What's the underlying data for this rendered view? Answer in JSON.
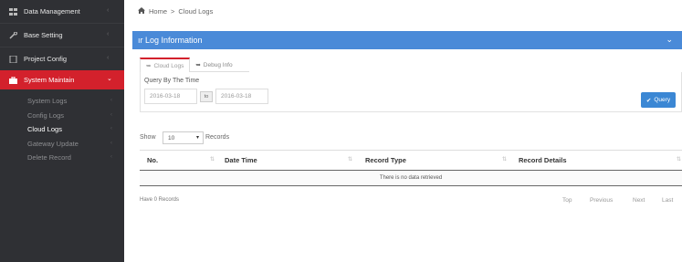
{
  "sidebar": {
    "items": [
      {
        "label": "Data Management",
        "icon": "grid-icon"
      },
      {
        "label": "Base Setting",
        "icon": "wrench-icon"
      },
      {
        "label": "Project Config",
        "icon": "document-icon"
      },
      {
        "label": "System Maintain",
        "icon": "briefcase-icon",
        "active": true
      }
    ],
    "sub_items": [
      {
        "label": "System Logs"
      },
      {
        "label": "Config Logs"
      },
      {
        "label": "Cloud Logs",
        "current": true
      },
      {
        "label": "Gateway Update"
      },
      {
        "label": "Delete Record"
      }
    ]
  },
  "breadcrumb": {
    "home": "Home",
    "separator": ">",
    "current": "Cloud Logs"
  },
  "panel": {
    "title": "ır Log Information",
    "collapse_icon": "chevron-down-icon"
  },
  "tabs": [
    {
      "label": "Cloud Logs",
      "active": true
    },
    {
      "label": "Debug Info",
      "active": false
    }
  ],
  "query": {
    "label": "Query By The Time",
    "start_date": "2016-03-18",
    "to_label": "to",
    "end_date": "2016-03-18",
    "button_label": "Query"
  },
  "length": {
    "show_label": "Show",
    "value": "10",
    "records_label": "Records"
  },
  "table": {
    "columns": [
      "No.",
      "Date Time",
      "Record Type",
      "Record Details"
    ],
    "empty_message": "There is no data retrieved"
  },
  "footer": {
    "info": "Have 0 Records",
    "pager": [
      "Top",
      "Previous",
      "Next",
      "Last"
    ]
  },
  "colors": {
    "sidebar_bg": "#2f3034",
    "active_red": "#d3212c",
    "panel_blue": "#4a8ad8",
    "button_blue": "#3b87d4"
  }
}
